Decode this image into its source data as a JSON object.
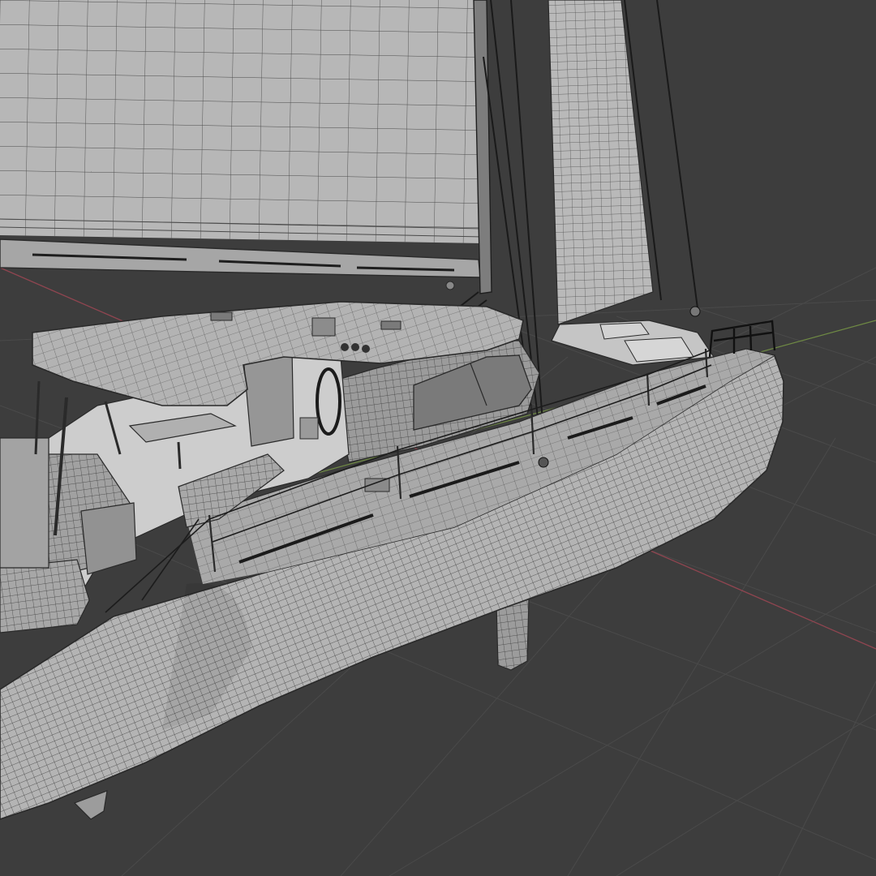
{
  "viewport": {
    "background_color": "#3d3d3d",
    "floor_grid_color": "#4b4b4b",
    "x_axis_color": "#9a4a52",
    "y_axis_color": "#7f9a4a",
    "wire_color": "#2a2a2a",
    "surface_light": "#b9b9b9",
    "surface_mid": "#a4a4a4",
    "surface_dark": "#8e8e8e"
  },
  "scene": {
    "objects": [
      "floor-grid",
      "main-hull",
      "keel",
      "rudder",
      "mainsail",
      "boom",
      "jib",
      "bimini-top",
      "coaming",
      "cabin-top",
      "cockpit",
      "helm-wheel",
      "cockpit-table",
      "bow-pulpit",
      "stanchions",
      "lifelines",
      "forestay",
      "shrouds",
      "mast"
    ]
  }
}
